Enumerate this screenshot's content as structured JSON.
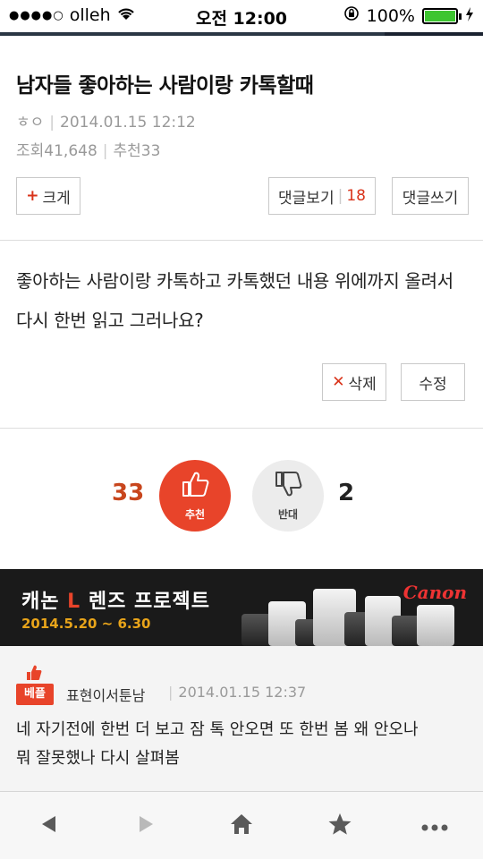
{
  "status_bar": {
    "carrier": "olleh",
    "time": "오전 12:00",
    "battery": "100%",
    "battery_level": 1.0
  },
  "post": {
    "title": "남자들 좋아하는 사람이랑 카톡할때",
    "author": "ㅎㅇ",
    "datetime": "2014.01.15 12:12",
    "views_label": "조회",
    "views": "41,648",
    "likes_label": "추천",
    "likes": "33",
    "enlarge_label": "크게",
    "view_comments_label": "댓글보기",
    "comment_count": "18",
    "write_comment_label": "댓글쓰기",
    "body": "좋아하는 사람이랑 카톡하고 카톡했던 내용 위에까지 올려서 다시 한번 읽고 그러나요?",
    "delete_label": "삭제",
    "edit_label": "수정"
  },
  "votes": {
    "up_count": "33",
    "up_label": "추천",
    "down_label": "반대",
    "down_count": "2"
  },
  "ad": {
    "title_pre": "캐논 ",
    "title_l": "L",
    "title_post": " 렌즈 프로젝트",
    "date_range": "2014.5.20 ~ 6.30",
    "brand": "Canon"
  },
  "comment": {
    "badge": "베플",
    "author": "표현이서툰남",
    "datetime": "2014.01.15 12:37",
    "text_line1": "네 자기전에 한번 더 보고 잠 톡 안오면 또 한번 봄 왜 안오나",
    "text_line2": "뭐 잘못했나 다시 살펴봄"
  },
  "toolbar": {
    "icons": [
      "back-icon",
      "forward-icon",
      "home-icon",
      "star-icon",
      "more-icon"
    ]
  },
  "colors": {
    "accent": "#e8442a",
    "count_red": "#d9331a",
    "ad_bg": "#1a1a1a"
  }
}
